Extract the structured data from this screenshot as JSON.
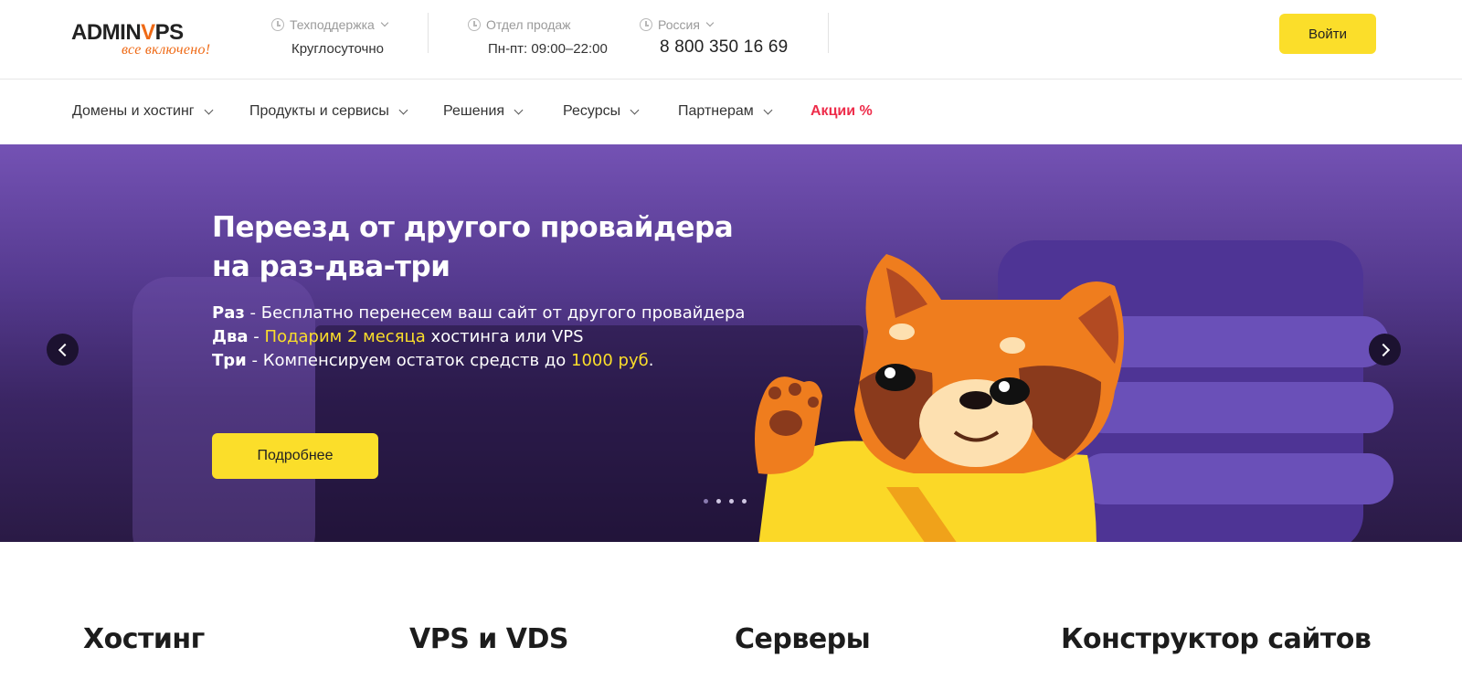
{
  "header": {
    "logo": {
      "text_main": "ADMIN",
      "text_accent_v": "V",
      "text_tail": "PS",
      "tagline": "все включено!"
    },
    "support": {
      "label": "Техподдержка",
      "value": "Круглосуточно"
    },
    "sales": {
      "label": "Отдел продаж",
      "value": "Пн-пт: 09:00–22:00"
    },
    "region": {
      "label": "Россия",
      "phone": "8 800 350 16 69"
    },
    "login_label": "Войти"
  },
  "nav": {
    "items": [
      {
        "label": "Домены и хостинг"
      },
      {
        "label": "Продукты и сервисы"
      },
      {
        "label": "Решения"
      },
      {
        "label": "Ресурсы"
      },
      {
        "label": "Партнерам"
      }
    ],
    "promo_label": "Акции %"
  },
  "hero": {
    "title_line1": "Переезд от другого провайдера",
    "title_line2": "на раз-два-три",
    "line1": {
      "strong": "Раз",
      "sep": " - ",
      "text": "Бесплатно перенесем ваш сайт от другого провайдера"
    },
    "line2": {
      "strong": "Два",
      "sep": " - ",
      "highlight": "Подарим 2 месяца",
      "text": " хостинга или VPS"
    },
    "line3": {
      "strong": "Три",
      "sep": " - ",
      "text": "Компенсируем остаток средств до ",
      "highlight": "1000 руб",
      "tail": "."
    },
    "cta_label": "Подробнее",
    "slides_total": 4,
    "active_slide": 1
  },
  "sections": [
    {
      "title": "Хостинг"
    },
    {
      "title": "VPS и VDS"
    },
    {
      "title": "Серверы"
    },
    {
      "title": "Конструктор сайтов"
    }
  ],
  "colors": {
    "brand_orange": "#ef6a16",
    "button_yellow": "#fbde2a",
    "promo_red": "#ee2c4a",
    "hero_purple": "#6a4aa8"
  }
}
